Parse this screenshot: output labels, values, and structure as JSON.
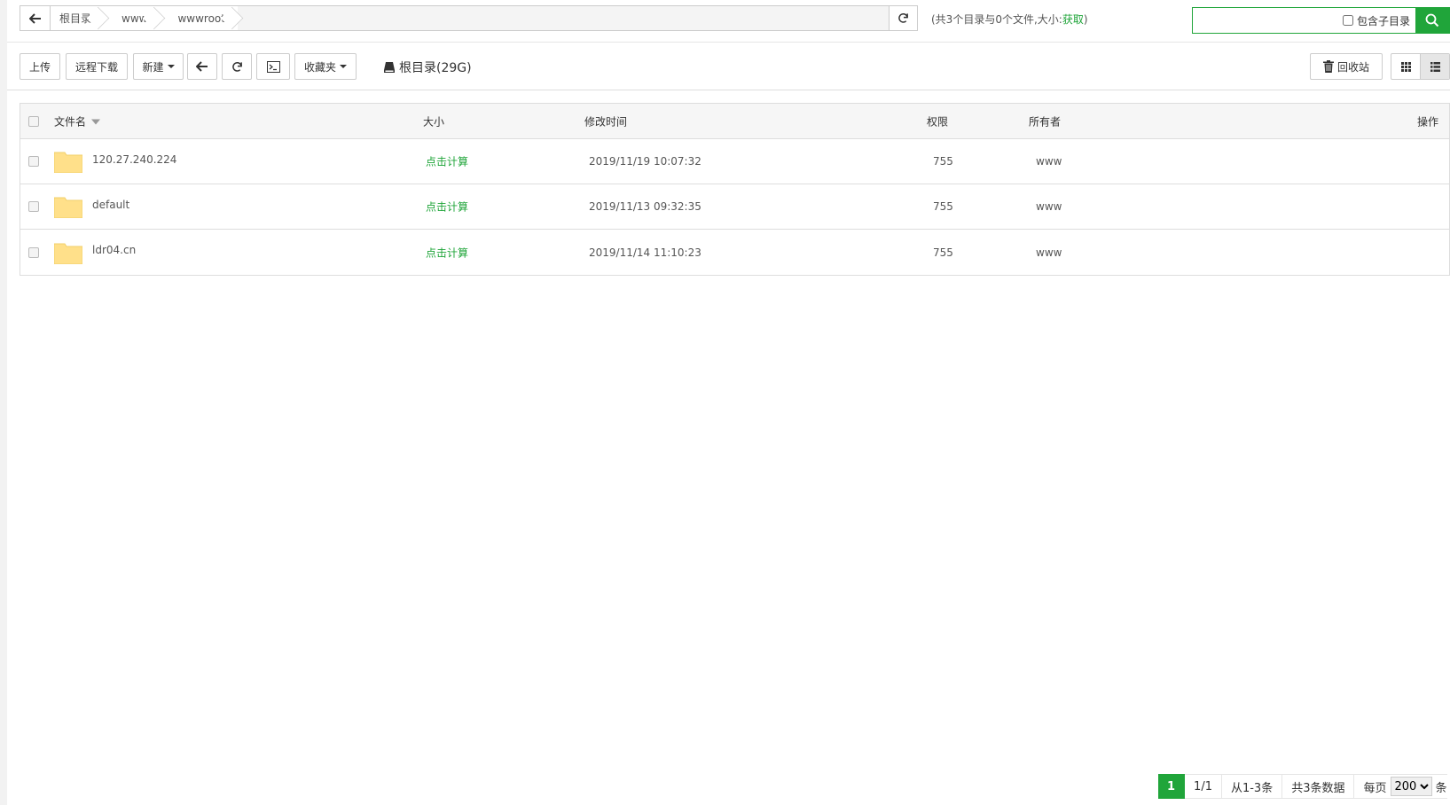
{
  "path_bar": {
    "crumbs": [
      "根目录",
      "www",
      "wwwroot"
    ],
    "info_prefix": "(共3个目录与0个文件,大小:",
    "info_link": "获取",
    "info_suffix": ")"
  },
  "search": {
    "placeholder": "",
    "subdir_label": "包含子目录"
  },
  "toolbar": {
    "upload": "上传",
    "remote_download": "远程下载",
    "new": "新建",
    "favorites": "收藏夹",
    "disk": "根目录(29G)",
    "recycle": "回收站"
  },
  "table": {
    "headers": {
      "name": "文件名",
      "size": "大小",
      "mtime": "修改时间",
      "perm": "权限",
      "owner": "所有者",
      "ops": "操作"
    },
    "rows": [
      {
        "name": "120.27.240.224",
        "size": "点击计算",
        "mtime": "2019/11/19 10:07:32",
        "perm": "755",
        "owner": "www"
      },
      {
        "name": "default",
        "size": "点击计算",
        "mtime": "2019/11/13 09:32:35",
        "perm": "755",
        "owner": "www"
      },
      {
        "name": "ldr04.cn",
        "size": "点击计算",
        "mtime": "2019/11/14 11:10:23",
        "perm": "755",
        "owner": "www"
      }
    ]
  },
  "pagination": {
    "current": "1",
    "pages": "1/1",
    "range": "从1-3条",
    "total": "共3条数据",
    "per_page_label": "每页",
    "per_page_value": "200",
    "unit": "条"
  },
  "colors": {
    "accent": "#20a53a",
    "folder": "#ffe08a"
  }
}
